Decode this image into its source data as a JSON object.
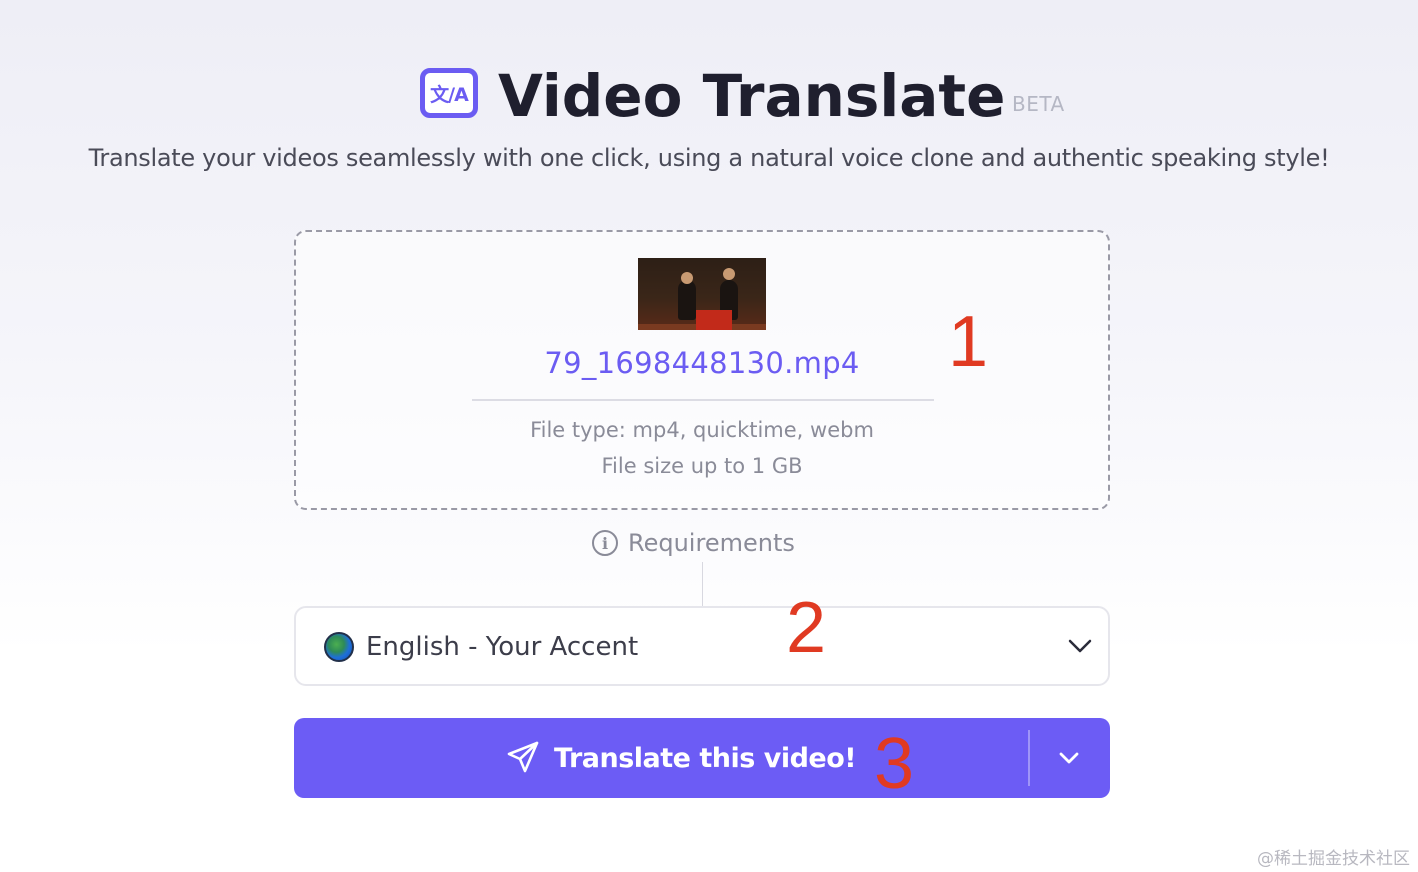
{
  "header": {
    "logo_text": "文/A",
    "title": "Video Translate",
    "badge": "BETA",
    "subtitle": "Translate your videos seamlessly with one click, using a natural voice clone and authentic speaking style!"
  },
  "upload": {
    "file_name": "79_1698448130.mp4",
    "file_types": "File type: mp4, quicktime, webm",
    "file_size": "File size up to 1 GB"
  },
  "requirements": {
    "icon": "info-icon",
    "label": "Requirements"
  },
  "language_select": {
    "icon": "globe-icon",
    "selected": "English - Your Accent"
  },
  "translate_button": {
    "icon": "send-icon",
    "label": "Translate this video!"
  },
  "annotations": [
    "1",
    "2",
    "3"
  ],
  "watermark": "@稀土掘金技术社区",
  "colors": {
    "accent": "#6c5cf5",
    "annotation": "#e03a22"
  }
}
